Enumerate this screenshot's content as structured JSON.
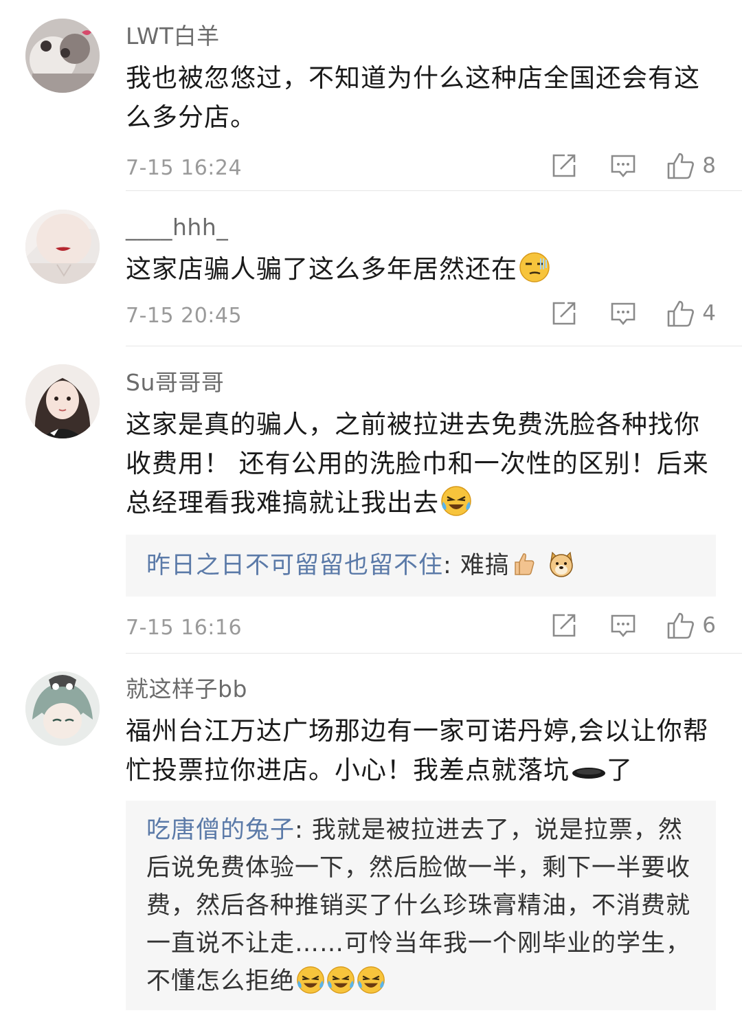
{
  "comments": [
    {
      "username": "LWT白羊",
      "text": "我也被忽悠过，不知道为什么这种店全国还会有这么多分店。",
      "time": "7-15 16:24",
      "likes": "8"
    },
    {
      "username": "____hhh_",
      "text": "这家店骗人骗了这么多年居然还在",
      "time": "7-15 20:45",
      "likes": "4"
    },
    {
      "username": "Su哥哥哥",
      "text": "这家是真的骗人，之前被拉进去免费洗脸各种找你收费用！ 还有公用的洗脸巾和一次性的区别！后来总经理看我难搞就让我出去",
      "reply_name": "昨日之日不可留留也留不住",
      "reply_text": ": 难搞",
      "time": "7-15 16:16",
      "likes": "6"
    },
    {
      "username": "就这样子bb",
      "text": "福州台江万达广场那边有一家可诺丹婷,会以让你帮忙投票拉你进店。小心！我差点就落坑",
      "text_tail": "了",
      "reply_name": "吃唐僧的兔子",
      "reply_text": ": 我就是被拉进去了，说是拉票，然后说免费体验一下，然后脸做一半，剩下一半要收费，然后各种推销买了什么珍珠膏精油，不消费就一直说不让走……可怜当年我一个刚毕业的学生，不懂怎么拒绝"
    }
  ],
  "icons": {
    "share": "share-icon",
    "reply": "comment-icon",
    "like": "thumbs-up-icon"
  }
}
